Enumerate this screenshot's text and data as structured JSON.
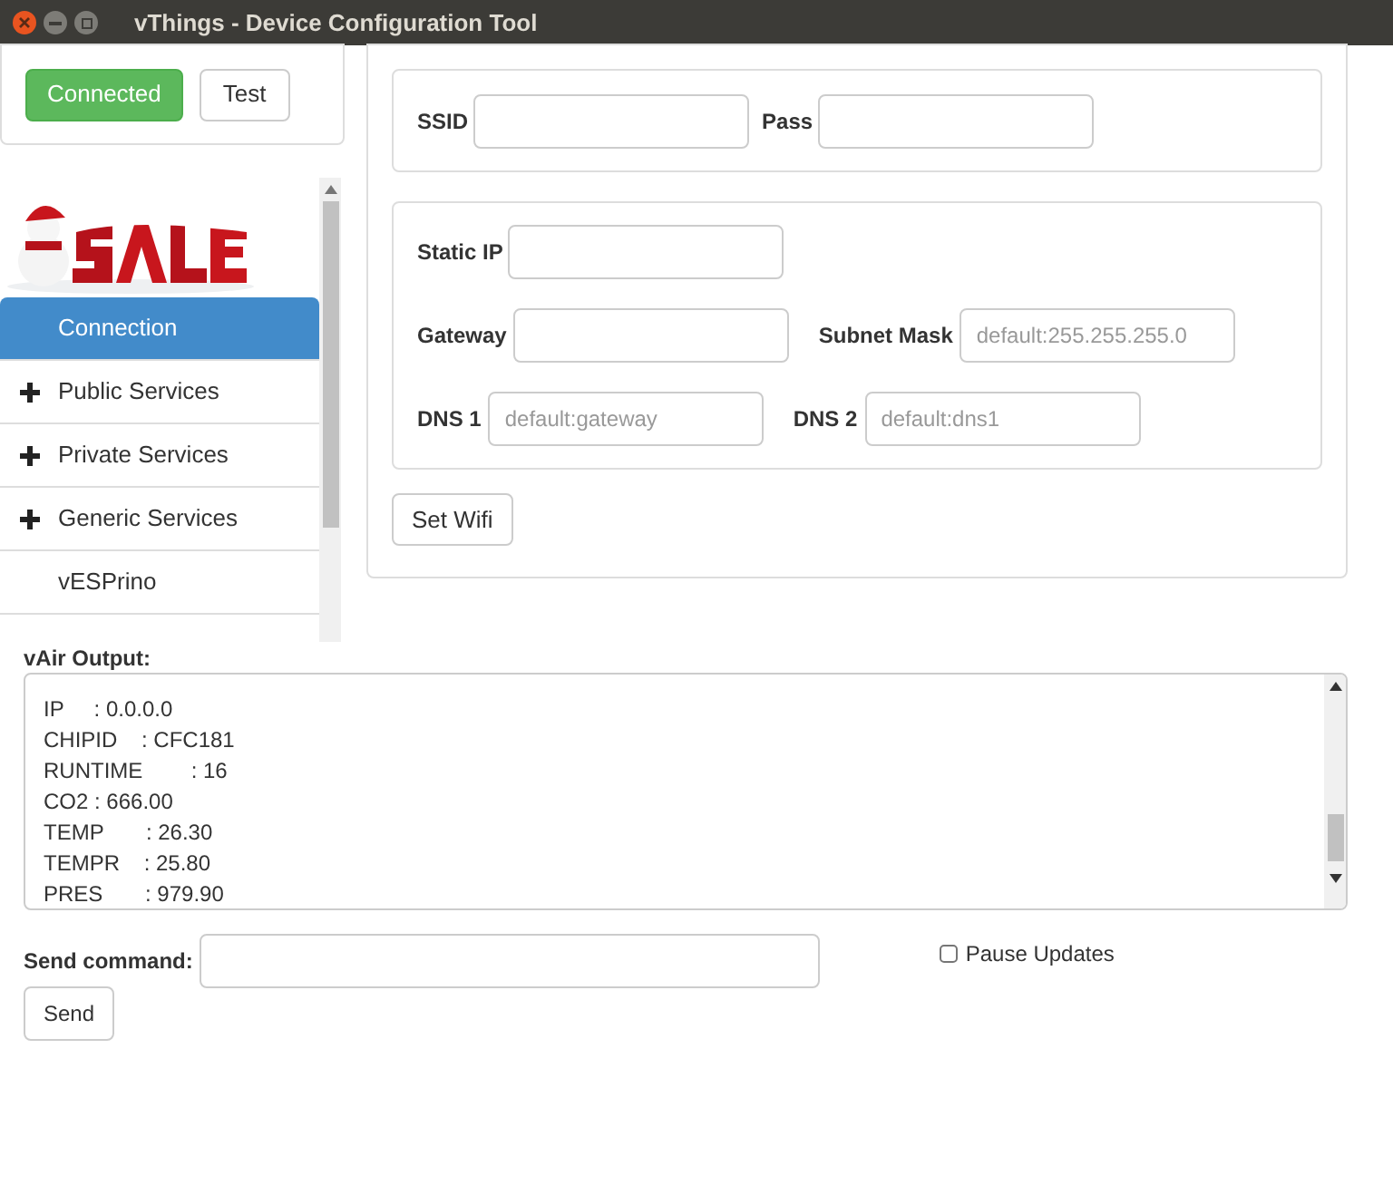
{
  "window": {
    "title": "vThings - Device Configuration Tool"
  },
  "connection": {
    "status": "Connected",
    "connected": true,
    "test_button": "Test"
  },
  "sidebar": {
    "items": [
      {
        "label": "Connection",
        "selected": true,
        "expandable": false
      },
      {
        "label": "Public Services",
        "selected": false,
        "expandable": true
      },
      {
        "label": "Private Services",
        "selected": false,
        "expandable": true
      },
      {
        "label": "Generic Services",
        "selected": false,
        "expandable": true
      },
      {
        "label": "vESPrino",
        "selected": false,
        "expandable": false
      }
    ]
  },
  "wifi": {
    "ssid_label": "SSID",
    "pass_label": "Pass"
  },
  "network": {
    "static_ip_label": "Static IP",
    "gateway_label": "Gateway",
    "subnet_label": "Subnet Mask",
    "subnet_placeholder": "default:255.255.255.0",
    "dns1_label": "DNS 1",
    "dns1_placeholder": "default:gateway",
    "dns2_label": "DNS 2",
    "dns2_placeholder": "default:dns1"
  },
  "set_wifi_button": "Set Wifi",
  "output": {
    "label": "vAir Output:",
    "lines": [
      "IP     : 0.0.0.0",
      "CHIPID    : CFC181",
      "RUNTIME        : 16",
      "CO2 : 666.00",
      "TEMP       : 26.30",
      "TEMPR    : 25.80",
      "PRES       : 979.90"
    ]
  },
  "command": {
    "label": "Send command:",
    "send_button": "Send",
    "pause_label": "Pause Updates",
    "pause_checked": false
  }
}
